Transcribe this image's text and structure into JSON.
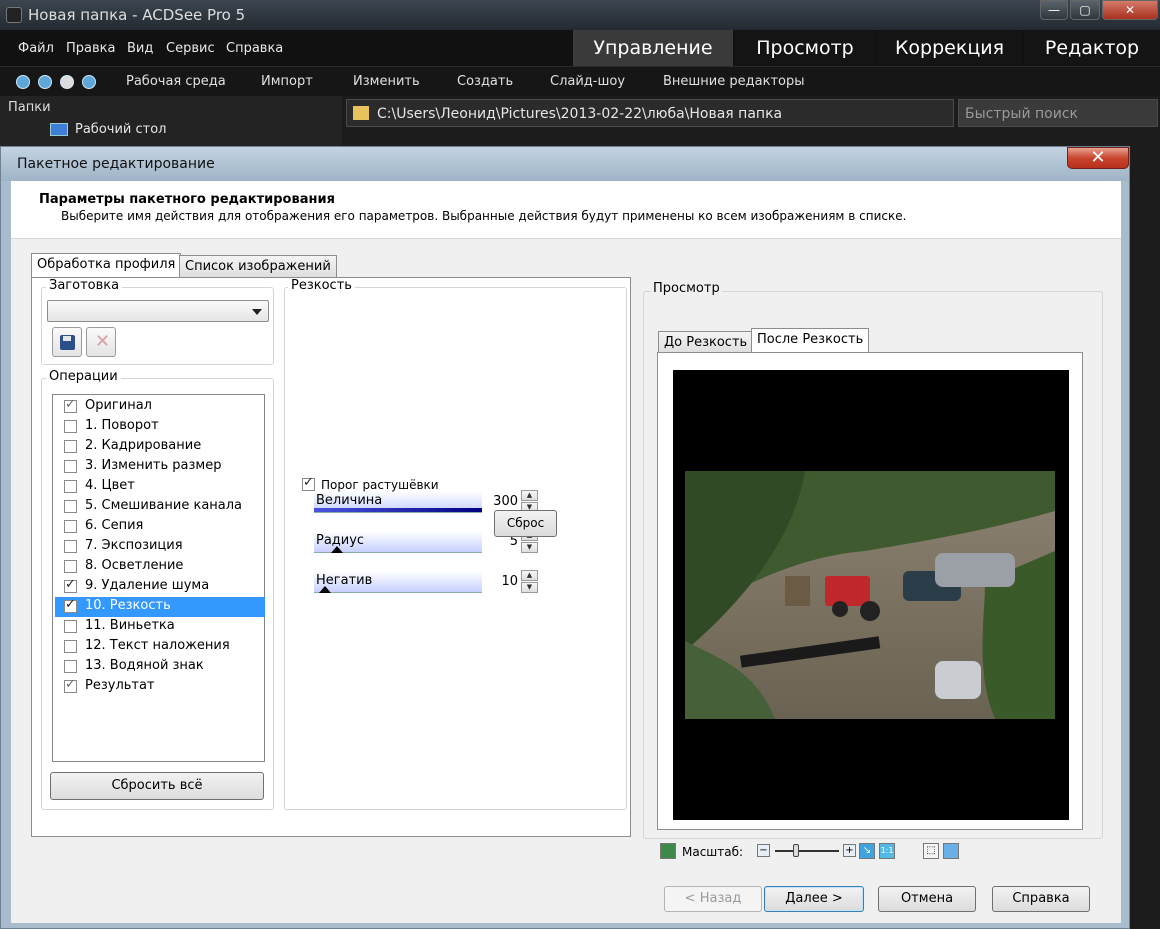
{
  "app": {
    "title": "Новая папка - ACDSee Pro 5",
    "minimize": "—",
    "maximize": "▢",
    "close": "✕"
  },
  "menu": [
    "Файл",
    "Правка",
    "Вид",
    "Сервис",
    "Справка"
  ],
  "modes": [
    "Управление",
    "Просмотр",
    "Коррекция",
    "Редактор"
  ],
  "toolbar": [
    "Рабочая среда",
    "Импорт",
    "Изменить",
    "Создать",
    "Слайд-шоу",
    "Внешние редакторы"
  ],
  "folders": {
    "header": "Папки",
    "tree_item": "Рабочий стол"
  },
  "path": "C:\\Users\\Леонид\\Pictures\\2013-02-22\\люба\\Новая папка",
  "quicksearch_placeholder": "Быстрый поиск",
  "dialog": {
    "title": "Пакетное редактирование",
    "close": "✕",
    "heading": "Параметры пакетного редактирования",
    "subheading": "Выберите имя действия для отображения его параметров. Выбранные действия будут применены ко всем изображениям в списке.",
    "tabs": [
      "Обработка профиля",
      "Список изображений"
    ],
    "preset_label": "Заготовка",
    "preset_value": "",
    "operations_label": "Операции",
    "operations": [
      {
        "label": "Оригинал",
        "checked": true,
        "locked": true
      },
      {
        "label": "1. Поворот",
        "checked": false
      },
      {
        "label": "2. Кадрирование",
        "checked": false
      },
      {
        "label": "3. Изменить размер",
        "checked": false
      },
      {
        "label": "4. Цвет",
        "checked": false
      },
      {
        "label": "5. Смешивание канала",
        "checked": false
      },
      {
        "label": "6. Сепия",
        "checked": false
      },
      {
        "label": "7. Экспозиция",
        "checked": false
      },
      {
        "label": "8. Осветление",
        "checked": false
      },
      {
        "label": "9. Удаление шума",
        "checked": true
      },
      {
        "label": "10. Резкость",
        "checked": true,
        "selected": true
      },
      {
        "label": "11. Виньетка",
        "checked": false
      },
      {
        "label": "12. Текст наложения",
        "checked": false
      },
      {
        "label": "13. Водяной знак",
        "checked": false
      },
      {
        "label": "Результат",
        "checked": true,
        "locked": true
      }
    ],
    "reset_all": "Сбросить всё",
    "sharpen": {
      "group_label": "Резкость",
      "amount_label": "Величина",
      "amount_value": "300",
      "amount_level": 1.0,
      "radius_label": "Радиус",
      "radius_value": "5",
      "radius_level": 0.1,
      "negative_label": "Негатив",
      "negative_value": "10",
      "negative_level": 0.03,
      "threshold_label": "Порог растушёвки",
      "threshold_checked": true,
      "reset": "Сброс"
    },
    "preview": {
      "label": "Просмотр",
      "tabs": [
        "До Резкость",
        "После Резкость"
      ],
      "zoom_label": "Масштаб:"
    },
    "buttons": {
      "back": "< Назад",
      "next": "Далее >",
      "cancel": "Отмена",
      "help": "Справка"
    }
  }
}
